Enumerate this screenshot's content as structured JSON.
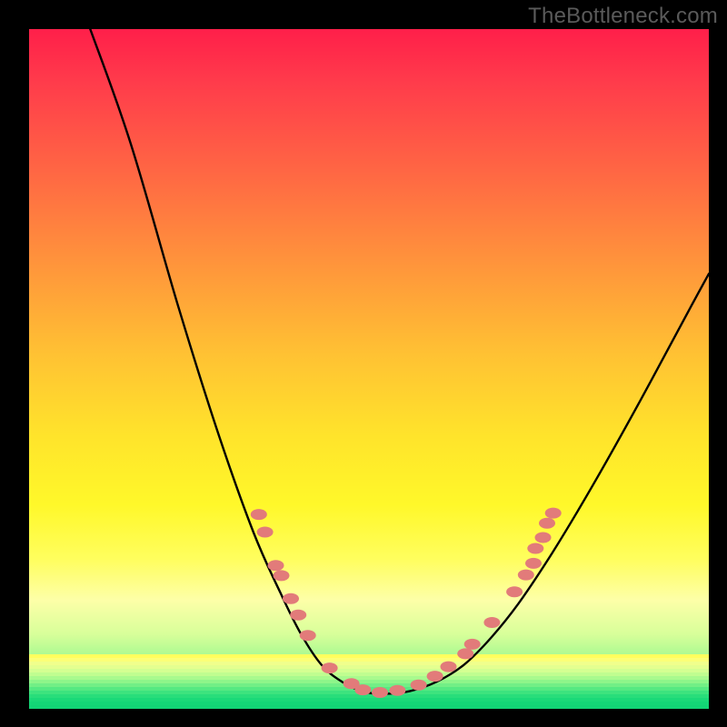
{
  "watermark": "TheBottleneck.com",
  "colors": {
    "frame": "#000000",
    "curve_stroke": "#000000",
    "marker_fill": "#e27b7a",
    "marker_stroke": "#c55a58",
    "gradient_top": "#ff1f4a",
    "gradient_bottom": "#18d877"
  },
  "chart_data": {
    "type": "line",
    "title": "",
    "xlabel": "",
    "ylabel": "",
    "xlim": [
      0,
      1
    ],
    "ylim": [
      0,
      1
    ],
    "legend_position": "none",
    "grid": false,
    "description": "V-shaped bottleneck curve over a vertical rainbow gradient (red → yellow → green). The curve descends steeply from top-left, reaches a flat bottom near center, then rises more gently toward the right edge. Coral-colored markers cluster near the bottom on both descending and ascending limbs.",
    "note": "No axes, ticks, data labels, or numeric values are rendered in the image. Marker and curve coordinates below are visual estimates in normalized [0,1] space (origin at top-left of the plot area).",
    "series": [
      {
        "name": "curve",
        "kind": "path",
        "points_normalized": [
          [
            0.09,
            0.0
          ],
          [
            0.15,
            0.17
          ],
          [
            0.22,
            0.41
          ],
          [
            0.28,
            0.6
          ],
          [
            0.33,
            0.74
          ],
          [
            0.37,
            0.83
          ],
          [
            0.4,
            0.89
          ],
          [
            0.43,
            0.935
          ],
          [
            0.46,
            0.96
          ],
          [
            0.49,
            0.974
          ],
          [
            0.52,
            0.978
          ],
          [
            0.56,
            0.974
          ],
          [
            0.6,
            0.96
          ],
          [
            0.64,
            0.935
          ],
          [
            0.68,
            0.895
          ],
          [
            0.72,
            0.845
          ],
          [
            0.77,
            0.77
          ],
          [
            0.83,
            0.67
          ],
          [
            0.9,
            0.545
          ],
          [
            0.97,
            0.415
          ],
          [
            1.0,
            0.36
          ]
        ]
      },
      {
        "name": "markers",
        "kind": "scatter",
        "points_normalized": [
          [
            0.338,
            0.714
          ],
          [
            0.347,
            0.74
          ],
          [
            0.363,
            0.789
          ],
          [
            0.371,
            0.804
          ],
          [
            0.385,
            0.838
          ],
          [
            0.396,
            0.862
          ],
          [
            0.41,
            0.892
          ],
          [
            0.442,
            0.94
          ],
          [
            0.474,
            0.963
          ],
          [
            0.491,
            0.972
          ],
          [
            0.516,
            0.976
          ],
          [
            0.542,
            0.973
          ],
          [
            0.573,
            0.965
          ],
          [
            0.597,
            0.952
          ],
          [
            0.617,
            0.938
          ],
          [
            0.642,
            0.919
          ],
          [
            0.652,
            0.905
          ],
          [
            0.681,
            0.873
          ],
          [
            0.714,
            0.828
          ],
          [
            0.731,
            0.803
          ],
          [
            0.742,
            0.786
          ],
          [
            0.745,
            0.764
          ],
          [
            0.756,
            0.748
          ],
          [
            0.762,
            0.727
          ],
          [
            0.771,
            0.712
          ]
        ]
      }
    ]
  }
}
